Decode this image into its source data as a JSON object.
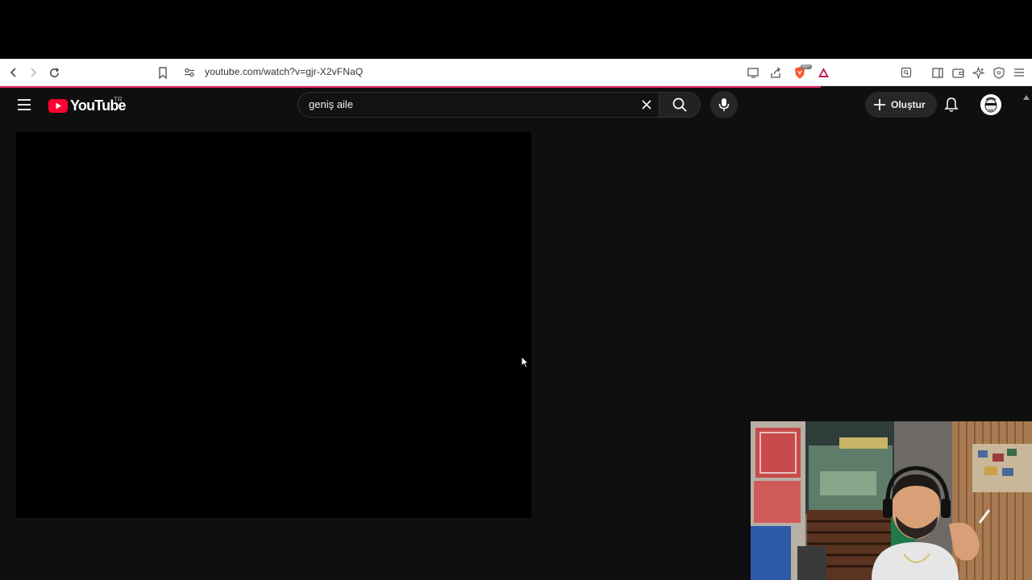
{
  "browser": {
    "url": "youtube.com/watch?v=gjr-X2vFNaQ",
    "toolbar_icons": [
      "back-icon",
      "forward-icon",
      "reload-icon",
      "bookmark-icon",
      "site-settings-icon",
      "cast-icon",
      "share-icon",
      "brave-shields-icon",
      "brave-rewards-icon",
      "reader-icon",
      "sidebar-icon",
      "wallet-icon",
      "leo-ai-icon",
      "vpn-icon",
      "menu-icon"
    ],
    "shields_badge": "99+"
  },
  "youtube": {
    "logo_text": "YouTube",
    "country_code": "TR",
    "search": {
      "value": "geniş aile"
    },
    "create_label": "Oluştur"
  },
  "colors": {
    "background": "#0f0f0f",
    "brand_red": "#ff0033",
    "loading_bar": "#e0245e",
    "toolbar_bg": "#ffffff"
  }
}
